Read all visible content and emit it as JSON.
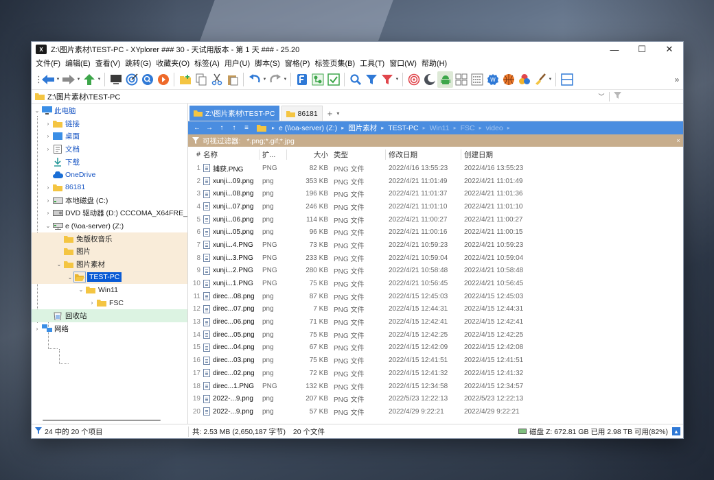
{
  "window": {
    "app_logo": "X",
    "title": "Z:\\图片素材\\TEST-PC - XYplorer ### 30 - 天试用版本 - 第 1 天 ### - 25.20",
    "minimize": "—",
    "maximize": "☐",
    "close": "✕"
  },
  "menu": [
    "文件(F)",
    "编辑(E)",
    "查看(V)",
    "跳转(G)",
    "收藏夹(O)",
    "标签(A)",
    "用户(U)",
    "脚本(S)",
    "窗格(P)",
    "标签页集(B)",
    "工具(T)",
    "窗口(W)",
    "帮助(H)"
  ],
  "toolbar_icons": [
    "menu-grip-icon",
    "back-arrow-icon",
    "forward-arrow-icon",
    "up-arrow-icon",
    "terminal-icon",
    "target-icon",
    "search-circle-icon",
    "record-icon",
    "new-folder-icon",
    "copy-icon",
    "cut-icon",
    "paste-icon",
    "undo-icon",
    "redo-icon",
    "font-f-icon",
    "tree-sync-icon",
    "checkbox-icon",
    "magnifier-icon",
    "filter-icon",
    "red-filter-icon",
    "spiral-icon",
    "moon-icon",
    "android-icon",
    "grid-icon",
    "list-view-icon",
    "badge-icon",
    "basketball-icon",
    "color-dots-icon",
    "brush-icon",
    "split-panel-icon",
    "more-icon"
  ],
  "address": {
    "path": "Z:\\图片素材\\TEST-PC",
    "dropdown": "﹀",
    "filter_icon": "funnel-icon"
  },
  "tree": {
    "items": [
      {
        "label": "此电脑",
        "icon": "pc-icon"
      },
      {
        "label": "链接",
        "icon": "folder-icon"
      },
      {
        "label": "桌面",
        "icon": "desktop-folder-icon"
      },
      {
        "label": "文档",
        "icon": "documents-icon"
      },
      {
        "label": "下载",
        "icon": "download-icon"
      },
      {
        "label": "OneDrive",
        "icon": "cloud-icon"
      },
      {
        "label": "86181",
        "icon": "folder-icon"
      },
      {
        "label": "本地磁盘 (C:)",
        "icon": "drive-icon"
      },
      {
        "label": "DVD 驱动器 (D:) CCCOMA_X64FRE_ZH-C",
        "icon": "dvd-icon"
      },
      {
        "label": "e (\\\\oa-server) (Z:)",
        "icon": "network-drive-icon"
      },
      {
        "label": "免版权音乐",
        "icon": "folder-icon"
      },
      {
        "label": "图片",
        "icon": "folder-icon"
      },
      {
        "label": "图片素材",
        "icon": "folder-icon"
      },
      {
        "label": "TEST-PC",
        "icon": "folder-open-icon"
      },
      {
        "label": "Win11",
        "icon": "folder-icon"
      },
      {
        "label": "FSC",
        "icon": "folder-icon"
      },
      {
        "label": "回收站",
        "icon": "recycle-bin-icon"
      },
      {
        "label": "网络",
        "icon": "network-icon"
      }
    ]
  },
  "tabs": [
    {
      "label": "Z:\\图片素材\\TEST-PC",
      "active": true
    },
    {
      "label": "86181",
      "active": false
    }
  ],
  "tab_add": "+",
  "tab_dropdown": "▾",
  "breadcrumb": {
    "nav": [
      "←",
      "→",
      "↑",
      "↑",
      "≡"
    ],
    "items": [
      "e (\\\\oa-server) (Z:)",
      "图片素材",
      "TEST-PC",
      "Win11",
      "FSC",
      "video"
    ],
    "separator": "▸"
  },
  "filter": {
    "label": "可视过滤器:",
    "pattern": "*.png;*.gif;*.jpg",
    "close": "×"
  },
  "columns": {
    "idx": "#",
    "name": "名称",
    "ext": "扩...",
    "size": "大小",
    "type": "类型",
    "modified": "修改日期",
    "created": "创建日期"
  },
  "files": [
    {
      "idx": "1",
      "name": "捕获.PNG",
      "ext": "PNG",
      "size": "82 KB",
      "type": "PNG 文件",
      "modified": "2022/4/16 13:55:23",
      "created": "2022/4/16 13:55:23"
    },
    {
      "idx": "2",
      "name": "xunji...09.png",
      "ext": "png",
      "size": "353 KB",
      "type": "PNG 文件",
      "modified": "2022/4/21 11:01:49",
      "created": "2022/4/21 11:01:49"
    },
    {
      "idx": "3",
      "name": "xunji...08.png",
      "ext": "png",
      "size": "196 KB",
      "type": "PNG 文件",
      "modified": "2022/4/21 11:01:37",
      "created": "2022/4/21 11:01:36"
    },
    {
      "idx": "4",
      "name": "xunji...07.png",
      "ext": "png",
      "size": "246 KB",
      "type": "PNG 文件",
      "modified": "2022/4/21 11:01:10",
      "created": "2022/4/21 11:01:10"
    },
    {
      "idx": "5",
      "name": "xunji...06.png",
      "ext": "png",
      "size": "114 KB",
      "type": "PNG 文件",
      "modified": "2022/4/21 11:00:27",
      "created": "2022/4/21 11:00:27"
    },
    {
      "idx": "6",
      "name": "xunji...05.png",
      "ext": "png",
      "size": "96 KB",
      "type": "PNG 文件",
      "modified": "2022/4/21 11:00:16",
      "created": "2022/4/21 11:00:15"
    },
    {
      "idx": "7",
      "name": "xunji...4.PNG",
      "ext": "PNG",
      "size": "73 KB",
      "type": "PNG 文件",
      "modified": "2022/4/21 10:59:23",
      "created": "2022/4/21 10:59:23"
    },
    {
      "idx": "8",
      "name": "xunji...3.PNG",
      "ext": "PNG",
      "size": "233 KB",
      "type": "PNG 文件",
      "modified": "2022/4/21 10:59:04",
      "created": "2022/4/21 10:59:04"
    },
    {
      "idx": "9",
      "name": "xunji...2.PNG",
      "ext": "PNG",
      "size": "280 KB",
      "type": "PNG 文件",
      "modified": "2022/4/21 10:58:48",
      "created": "2022/4/21 10:58:48"
    },
    {
      "idx": "10",
      "name": "xunji...1.PNG",
      "ext": "PNG",
      "size": "75 KB",
      "type": "PNG 文件",
      "modified": "2022/4/21 10:56:45",
      "created": "2022/4/21 10:56:45"
    },
    {
      "idx": "11",
      "name": "direc...08.png",
      "ext": "png",
      "size": "87 KB",
      "type": "PNG 文件",
      "modified": "2022/4/15 12:45:03",
      "created": "2022/4/15 12:45:03"
    },
    {
      "idx": "12",
      "name": "direc...07.png",
      "ext": "png",
      "size": "7 KB",
      "type": "PNG 文件",
      "modified": "2022/4/15 12:44:31",
      "created": "2022/4/15 12:44:31"
    },
    {
      "idx": "13",
      "name": "direc...06.png",
      "ext": "png",
      "size": "71 KB",
      "type": "PNG 文件",
      "modified": "2022/4/15 12:42:41",
      "created": "2022/4/15 12:42:41"
    },
    {
      "idx": "14",
      "name": "direc...05.png",
      "ext": "png",
      "size": "75 KB",
      "type": "PNG 文件",
      "modified": "2022/4/15 12:42:25",
      "created": "2022/4/15 12:42:25"
    },
    {
      "idx": "15",
      "name": "direc...04.png",
      "ext": "png",
      "size": "67 KB",
      "type": "PNG 文件",
      "modified": "2022/4/15 12:42:09",
      "created": "2022/4/15 12:42:08"
    },
    {
      "idx": "16",
      "name": "direc...03.png",
      "ext": "png",
      "size": "75 KB",
      "type": "PNG 文件",
      "modified": "2022/4/15 12:41:51",
      "created": "2022/4/15 12:41:51"
    },
    {
      "idx": "17",
      "name": "direc...02.png",
      "ext": "png",
      "size": "72 KB",
      "type": "PNG 文件",
      "modified": "2022/4/15 12:41:32",
      "created": "2022/4/15 12:41:32"
    },
    {
      "idx": "18",
      "name": "direc...1.PNG",
      "ext": "PNG",
      "size": "132 KB",
      "type": "PNG 文件",
      "modified": "2022/4/15 12:34:58",
      "created": "2022/4/15 12:34:57"
    },
    {
      "idx": "19",
      "name": "2022-...9.png",
      "ext": "png",
      "size": "207 KB",
      "type": "PNG 文件",
      "modified": "2022/5/23 12:22:13",
      "created": "2022/5/23 12:22:13"
    },
    {
      "idx": "20",
      "name": "2022-...9.png",
      "ext": "png",
      "size": "57 KB",
      "type": "PNG 文件",
      "modified": "2022/4/29 9:22:21",
      "created": "2022/4/29 9:22:21"
    }
  ],
  "status": {
    "items_count": "24 中的 20 个项目",
    "total": "共: 2.53 MB (2,650,187 字节)",
    "files": "20 个文件",
    "disk": "磁盘 Z:  672.81 GB 已用   2.98 TB 可用(82%)",
    "up_button": "▲"
  },
  "colors": {
    "accent": "#4a8de0",
    "filter_bar": "#c7ad8c",
    "tree_selection": "#0a5bd5"
  }
}
